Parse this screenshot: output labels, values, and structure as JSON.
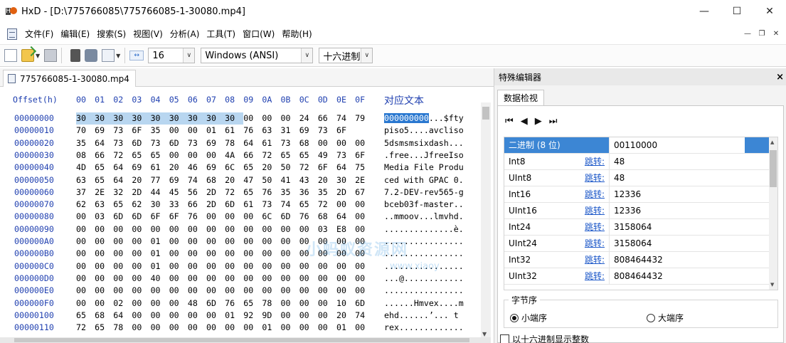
{
  "window": {
    "title": "HxD - [D:\\775766085\\775766085-1-30080.mp4]"
  },
  "menu": {
    "items": [
      "文件(F)",
      "编辑(E)",
      "搜索(S)",
      "视图(V)",
      "分析(A)",
      "工具(T)",
      "窗口(W)",
      "帮助(H)"
    ]
  },
  "toolbar": {
    "bytes_per_row": "16",
    "charset": "Windows (ANSI)",
    "offset_base": "十六进制"
  },
  "tab": {
    "filename": "775766085-1-30080.mp4"
  },
  "hex": {
    "offset_label": "Offset(h)",
    "columns": [
      "00",
      "01",
      "02",
      "03",
      "04",
      "05",
      "06",
      "07",
      "08",
      "09",
      "0A",
      "0B",
      "0C",
      "0D",
      "0E",
      "0F"
    ],
    "text_label": "对应文本",
    "rows": [
      {
        "offset": "00000000",
        "bytes": [
          "30",
          "30",
          "30",
          "30",
          "30",
          "30",
          "30",
          "30",
          "30",
          "00",
          "00",
          "00",
          "24",
          "66",
          "74",
          "79"
        ],
        "text_sel": "000000000",
        "text": "...$fty"
      },
      {
        "offset": "00000010",
        "bytes": [
          "70",
          "69",
          "73",
          "6F",
          "35",
          "00",
          "00",
          "01",
          "61",
          "76",
          "63",
          "31",
          "69",
          "73",
          "6F"
        ],
        "text_sel": "",
        "text": "piso5....avcliso"
      },
      {
        "offset": "00000020",
        "bytes": [
          "35",
          "64",
          "73",
          "6D",
          "73",
          "6D",
          "73",
          "69",
          "78",
          "64",
          "61",
          "73",
          "68",
          "00",
          "00",
          "00"
        ],
        "text_sel": "",
        "text": "5dsmsmsixdash..."
      },
      {
        "offset": "00000030",
        "bytes": [
          "08",
          "66",
          "72",
          "65",
          "65",
          "00",
          "00",
          "00",
          "4A",
          "66",
          "72",
          "65",
          "65",
          "49",
          "73",
          "6F"
        ],
        "text_sel": "",
        "text": ".free...JfreeIso"
      },
      {
        "offset": "00000040",
        "bytes": [
          "4D",
          "65",
          "64",
          "69",
          "61",
          "20",
          "46",
          "69",
          "6C",
          "65",
          "20",
          "50",
          "72",
          "6F",
          "64",
          "75"
        ],
        "text_sel": "",
        "text": "Media File Produ"
      },
      {
        "offset": "00000050",
        "bytes": [
          "63",
          "65",
          "64",
          "20",
          "77",
          "69",
          "74",
          "68",
          "20",
          "47",
          "50",
          "41",
          "43",
          "20",
          "30",
          "2E"
        ],
        "text_sel": "",
        "text": "ced with GPAC 0."
      },
      {
        "offset": "00000060",
        "bytes": [
          "37",
          "2E",
          "32",
          "2D",
          "44",
          "45",
          "56",
          "2D",
          "72",
          "65",
          "76",
          "35",
          "36",
          "35",
          "2D",
          "67"
        ],
        "text_sel": "",
        "text": "7.2-DEV-rev565-g"
      },
      {
        "offset": "00000070",
        "bytes": [
          "62",
          "63",
          "65",
          "62",
          "30",
          "33",
          "66",
          "2D",
          "6D",
          "61",
          "73",
          "74",
          "65",
          "72",
          "00",
          "00"
        ],
        "text_sel": "",
        "text": "bceb03f-master.."
      },
      {
        "offset": "00000080",
        "bytes": [
          "00",
          "03",
          "6D",
          "6D",
          "6F",
          "6F",
          "76",
          "00",
          "00",
          "00",
          "6C",
          "6D",
          "76",
          "68",
          "64",
          "00"
        ],
        "text_sel": "",
        "text": "..mmoov...lmvhd."
      },
      {
        "offset": "00000090",
        "bytes": [
          "00",
          "00",
          "00",
          "00",
          "00",
          "00",
          "00",
          "00",
          "00",
          "00",
          "00",
          "00",
          "00",
          "03",
          "E8",
          "00"
        ],
        "text_sel": "",
        "text": "..............è."
      },
      {
        "offset": "000000A0",
        "bytes": [
          "00",
          "00",
          "00",
          "00",
          "01",
          "00",
          "00",
          "00",
          "00",
          "00",
          "00",
          "00",
          "00",
          "00",
          "00",
          "00"
        ],
        "text_sel": "",
        "text": "................"
      },
      {
        "offset": "000000B0",
        "bytes": [
          "00",
          "00",
          "00",
          "00",
          "01",
          "00",
          "00",
          "00",
          "00",
          "00",
          "00",
          "00",
          "00",
          "00",
          "00",
          "00"
        ],
        "text_sel": "",
        "text": "................"
      },
      {
        "offset": "000000C0",
        "bytes": [
          "00",
          "00",
          "00",
          "00",
          "01",
          "00",
          "00",
          "00",
          "00",
          "00",
          "00",
          "00",
          "00",
          "00",
          "00",
          "00"
        ],
        "text_sel": "",
        "text": "................"
      },
      {
        "offset": "000000D0",
        "bytes": [
          "00",
          "00",
          "00",
          "00",
          "40",
          "00",
          "00",
          "00",
          "00",
          "00",
          "00",
          "00",
          "00",
          "00",
          "00",
          "00"
        ],
        "text_sel": "",
        "text": "...@............"
      },
      {
        "offset": "000000E0",
        "bytes": [
          "00",
          "00",
          "00",
          "00",
          "00",
          "00",
          "00",
          "00",
          "00",
          "00",
          "00",
          "00",
          "00",
          "00",
          "00",
          "00"
        ],
        "text_sel": "",
        "text": "................"
      },
      {
        "offset": "000000F0",
        "bytes": [
          "00",
          "00",
          "02",
          "00",
          "00",
          "00",
          "48",
          "6D",
          "76",
          "65",
          "78",
          "00",
          "00",
          "00",
          "10",
          "6D"
        ],
        "text_sel": "",
        "text": "......Hmvex....m"
      },
      {
        "offset": "00000100",
        "bytes": [
          "65",
          "68",
          "64",
          "00",
          "00",
          "00",
          "00",
          "00",
          "01",
          "92",
          "9D",
          "00",
          "00",
          "00",
          "20",
          "74"
        ],
        "text_sel": "",
        "text": "ehd......’... t"
      },
      {
        "offset": "00000110",
        "bytes": [
          "72",
          "65",
          "78",
          "00",
          "00",
          "00",
          "00",
          "00",
          "00",
          "00",
          "01",
          "00",
          "00",
          "00",
          "01",
          "00"
        ],
        "text_sel": "",
        "text": "rex............."
      }
    ]
  },
  "watermark": {
    "main": "小蚂蚁资源网",
    "url": "www.xiaoy"
  },
  "panel": {
    "title": "特殊编辑器",
    "tab": "数据检视",
    "jump_label": "跳转:",
    "rows": [
      {
        "name": "二进制 (8 位)",
        "jump": false,
        "value": "00110000"
      },
      {
        "name": "Int8",
        "jump": true,
        "value": "48"
      },
      {
        "name": "UInt8",
        "jump": true,
        "value": "48"
      },
      {
        "name": "Int16",
        "jump": true,
        "value": "12336"
      },
      {
        "name": "UInt16",
        "jump": true,
        "value": "12336"
      },
      {
        "name": "Int24",
        "jump": true,
        "value": "3158064"
      },
      {
        "name": "UInt24",
        "jump": true,
        "value": "3158064"
      },
      {
        "name": "Int32",
        "jump": true,
        "value": "808464432"
      },
      {
        "name": "UInt32",
        "jump": true,
        "value": "808464432"
      }
    ],
    "byte_order_label": "字节序",
    "little_endian": "小端序",
    "big_endian": "大端序",
    "hex_ints_label": "以十六进制显示整数"
  }
}
